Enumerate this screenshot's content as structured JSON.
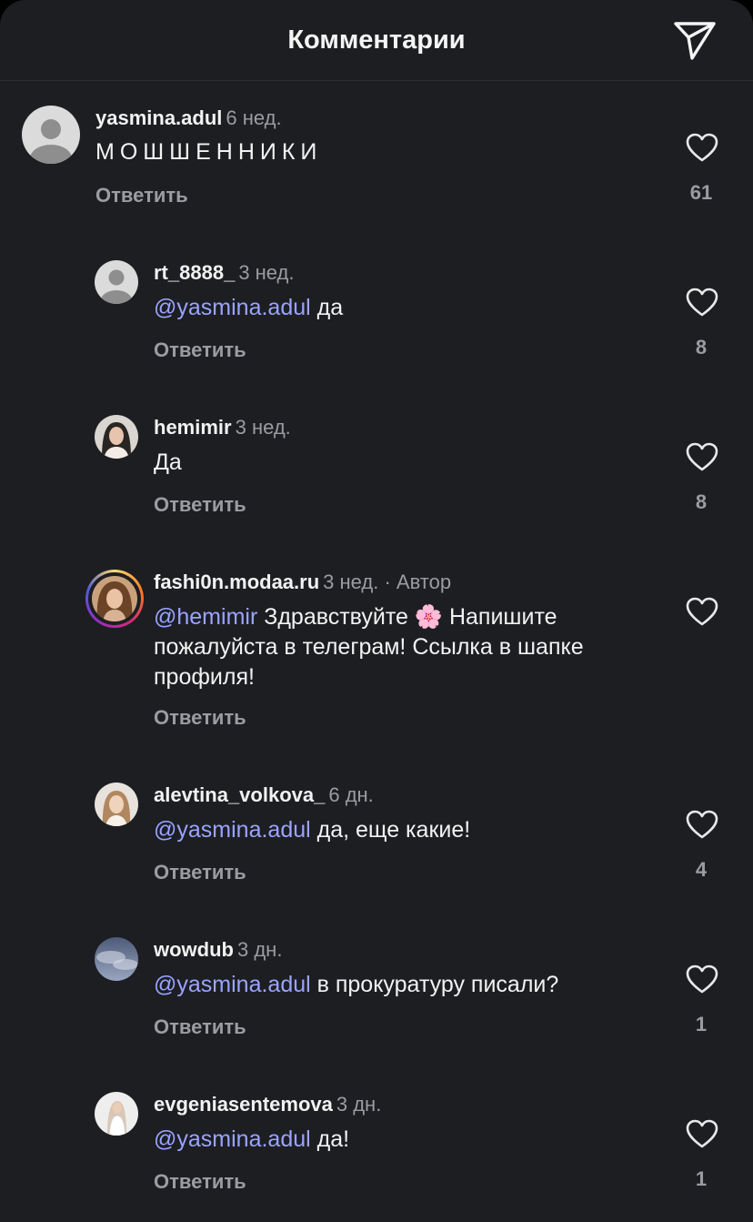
{
  "header": {
    "title": "Комментарии"
  },
  "reply_label": "Ответить",
  "author_label": "· Автор",
  "comments": [
    {
      "username": "yasmina.adul",
      "time": "6 нед.",
      "text": "МОШШЕННИКИ",
      "likes": "61"
    },
    {
      "username": "rt_8888_",
      "time": "3 нед.",
      "mention": "@yasmina.adul",
      "text": " да",
      "likes": "8"
    },
    {
      "username": "hemimir",
      "time": "3 нед.",
      "text": "Да",
      "likes": "8"
    },
    {
      "username": "fashi0n.modaa.ru",
      "time": "3 нед.",
      "mention": "@hemimir",
      "text": " Здравствуйте 🌸 Напишите пожалуйста в телеграм! Ссылка в шапке профиля!",
      "likes": ""
    },
    {
      "username": "alevtina_volkova_",
      "time": "6 дн.",
      "mention": "@yasmina.adul",
      "text": " да, еще какие!",
      "likes": "4"
    },
    {
      "username": "wowdub",
      "time": "3 дн.",
      "mention": "@yasmina.adul",
      "text": " в прокуратуру писали?",
      "likes": "1"
    },
    {
      "username": "evgeniasentemova",
      "time": "3 дн.",
      "mention": "@yasmina.adul",
      "text": " да!",
      "likes": "1"
    }
  ],
  "icons": {
    "share": "paper-plane-icon",
    "like": "heart-outline-icon",
    "default_avatar": "default-avatar-icon"
  },
  "colors": {
    "background": "#1d1e22",
    "mention": "#9aa4ff",
    "secondary_text": "#9b9ca1"
  }
}
